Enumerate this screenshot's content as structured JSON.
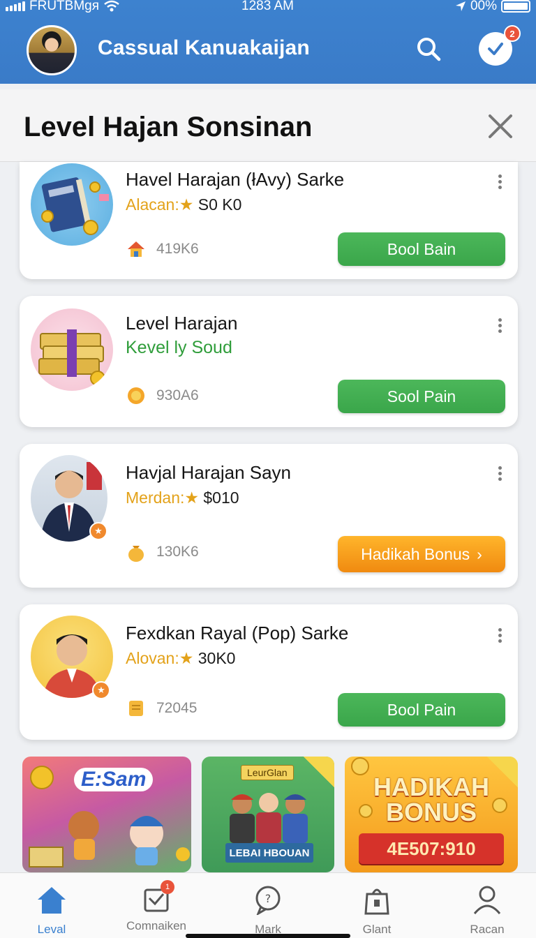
{
  "status_bar": {
    "carrier": "FRUTBMgя",
    "time": "1283 AM",
    "battery": "00%"
  },
  "header": {
    "title": "Cassual Kanuakaijan",
    "notification_count": "2",
    "icons": [
      "search-icon",
      "checkmark-icon"
    ]
  },
  "section": {
    "title": "Level Hajan Sonsinan"
  },
  "cards": [
    {
      "title": "Havel Harajan (łAvy) Sarke",
      "sub_label": "Alacan:",
      "sub_star": "★",
      "sub_amount": "S0 K0",
      "stat": "419K6",
      "button": "Bool Bain",
      "button_style": "green"
    },
    {
      "title": "Level Harajan",
      "sub_label": "Kevel ly Soud",
      "stat": "930A6",
      "button": "Sool Pain",
      "button_style": "green"
    },
    {
      "title": "Havjal Harajan Sayn",
      "sub_label": "Merdan:",
      "sub_star": "★",
      "sub_amount": "$010",
      "stat": "130K6",
      "button": "Hadikah Bonus",
      "button_arrow": "›",
      "button_style": "orange"
    },
    {
      "title": "Fexdkan Rayal (Pop) Sarke",
      "sub_label": "Alovan:",
      "sub_star": "★",
      "sub_amount": "30K0",
      "stat": "72045",
      "button": "Bool Pain",
      "button_style": "green"
    }
  ],
  "banners": [
    {
      "label": "E:Sam"
    },
    {
      "chip": "LeurGlan",
      "caption": "LEBAI HBOUAN"
    },
    {
      "title_line1": "HADIKAH",
      "title_line2": "BONUS",
      "ribbon": "4E507:910"
    }
  ],
  "bottom_nav": [
    {
      "label": "Leval",
      "icon": "home-icon",
      "active": true
    },
    {
      "label": "Comnaiken",
      "icon": "inbox-icon",
      "badge": "1"
    },
    {
      "label": "Mark",
      "icon": "chat-icon"
    },
    {
      "label": "Glant",
      "icon": "gift-bag-icon"
    },
    {
      "label": "Racan",
      "icon": "profile-icon"
    }
  ],
  "colors": {
    "header_blue": "#3a7bc8",
    "button_green": "#3aa64a",
    "button_orange": "#f08a10",
    "gold_text": "#e3a21a",
    "nav_active": "#3a80cf"
  }
}
